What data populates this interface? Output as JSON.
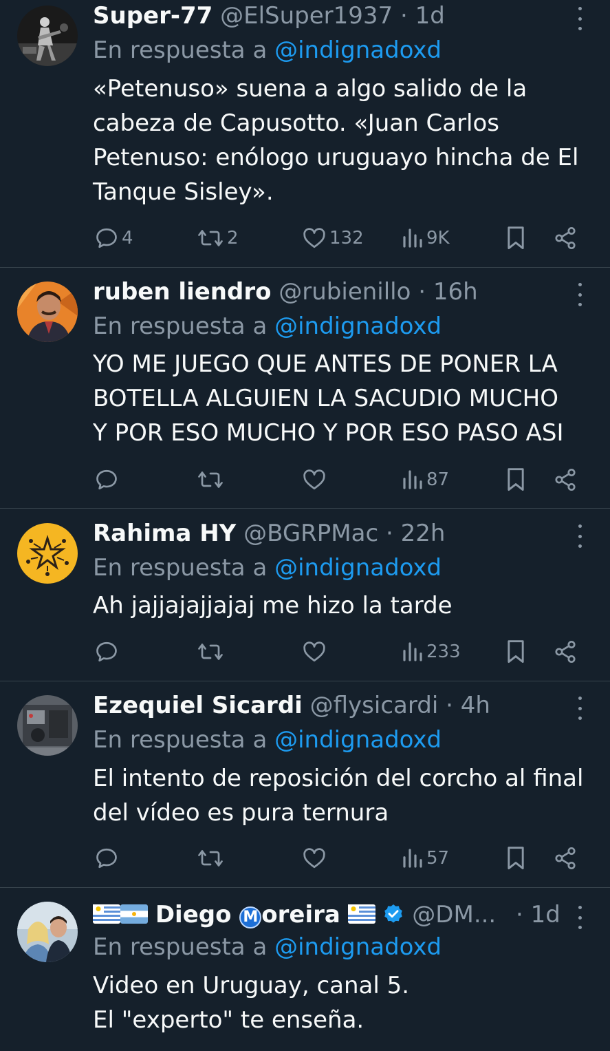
{
  "reply_prefix": "En respuesta a",
  "reply_mention": "@indignadoxd",
  "colors": {
    "background": "#15202b",
    "muted": "#8b98a5",
    "accent": "#1d9bf0",
    "divider": "#38444d"
  },
  "tweets": [
    {
      "name": "Super-77",
      "handle": "@ElSuper1937",
      "separator": "·",
      "time": "1d",
      "text": "«Petenuso» suena a algo salido de la\ncabeza de Capusotto. «Juan Carlos\nPetenuso: enólogo uruguayo hincha de El\nTanque Sisley».",
      "replies": "4",
      "retweets": "2",
      "likes": "132",
      "views": "9K"
    },
    {
      "name": "ruben liendro",
      "handle": "@rubienillo",
      "separator": "·",
      "time": "16h",
      "text": "YO ME JUEGO QUE ANTES DE PONER LA\nBOTELLA ALGUIEN LA SACUDIO MUCHO\nY POR ESO MUCHO Y POR ESO PASO ASI",
      "replies": "",
      "retweets": "",
      "likes": "",
      "views": "87"
    },
    {
      "name": "Rahima HY",
      "handle": "@BGRPMac",
      "separator": "·",
      "time": "22h",
      "text": "Ah jajjajajjajaj me hizo la tarde",
      "replies": "",
      "retweets": "",
      "likes": "",
      "views": "233"
    },
    {
      "name": "Ezequiel Sicardi",
      "handle": "@flysicardi",
      "separator": "·",
      "time": "4h",
      "text": "El intento de reposición del corcho al final\ndel vídeo es pura ternura",
      "replies": "",
      "retweets": "",
      "likes": "",
      "views": "57"
    },
    {
      "name_prefix": "Diego ",
      "name_badge": "M",
      "name_suffix": "oreira",
      "handle": "@DM...",
      "separator": "·",
      "time": "1d",
      "text": "Video en Uruguay, canal 5.\nEl \"experto\" te enseña."
    }
  ],
  "icons": {
    "reply": "comment-bubble-icon",
    "retweet": "retweet-icon",
    "like": "heart-icon",
    "views": "bar-chart-icon",
    "bookmark": "bookmark-icon",
    "share": "share-icon",
    "more": "more-vertical-icon",
    "verified": "verified-badge-icon"
  }
}
